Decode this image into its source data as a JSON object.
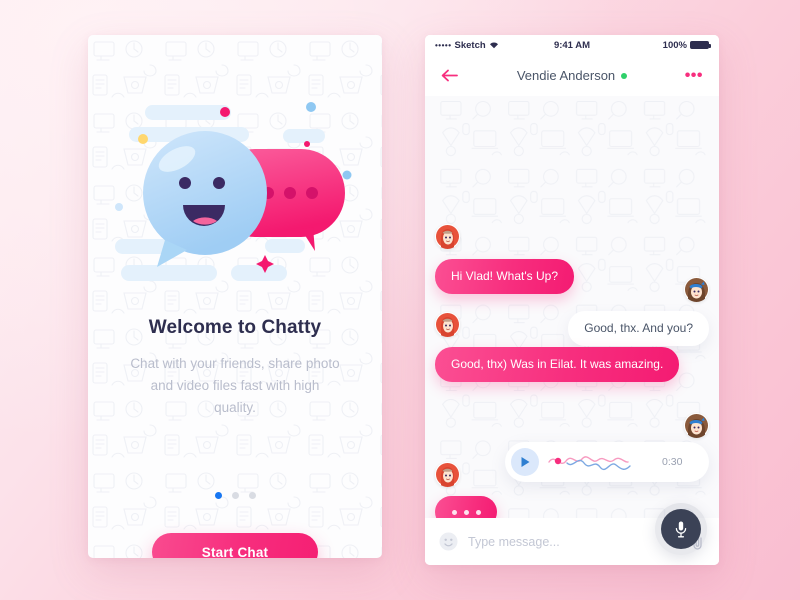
{
  "theme": {
    "pink": "#f72e7e",
    "pink_light": "#fb4f93",
    "navy": "#2e2e4f",
    "text_gray": "#4a5568",
    "muted": "#b9bdcc",
    "online_green": "#2fd06a",
    "active_dot_blue": "#1877f2",
    "page_background": "#fbcdda"
  },
  "onboarding": {
    "illustration_name": "chat-bubbles-smiley-illustration",
    "title": "Welcome to Chatty",
    "subtitle": "Chat with your friends, share photo and video files fast with high quality.",
    "pagination": {
      "total": 3,
      "active_index": 0
    },
    "start_button_label": "Start Chat"
  },
  "chat": {
    "statusbar": {
      "signal_dots": "•••••",
      "carrier": "Sketch",
      "wifi_icon": "wifi-icon",
      "time": "9:41 AM",
      "battery_percent": "100%",
      "battery_icon": "battery-full-icon"
    },
    "header": {
      "back_icon": "back-arrow-icon",
      "title": "Vendie Anderson",
      "online": true,
      "more_label": "•••"
    },
    "messages": [
      {
        "id": "m1",
        "from": "them",
        "text": "Hi Vlad! What's Up?",
        "avatar": "avatar-vendie"
      },
      {
        "id": "m2",
        "from": "me",
        "text": "Good, thx. And you?",
        "avatar": "avatar-vlad"
      },
      {
        "id": "m3",
        "from": "them",
        "text": "Good, thx) Was in Eilat. It was amazing.",
        "avatar": "avatar-vendie"
      },
      {
        "id": "m4",
        "from": "me",
        "type": "voice",
        "duration": "0:30",
        "play_icon": "play-icon",
        "avatar": "avatar-vlad"
      },
      {
        "id": "m5",
        "from": "them",
        "type": "typing",
        "avatar": "avatar-vendie"
      }
    ],
    "input": {
      "emoji_icon": "emoji-smiley-icon",
      "placeholder": "Type message...",
      "value": "",
      "attach_icon": "paperclip-icon",
      "mic_icon": "microphone-icon"
    }
  }
}
